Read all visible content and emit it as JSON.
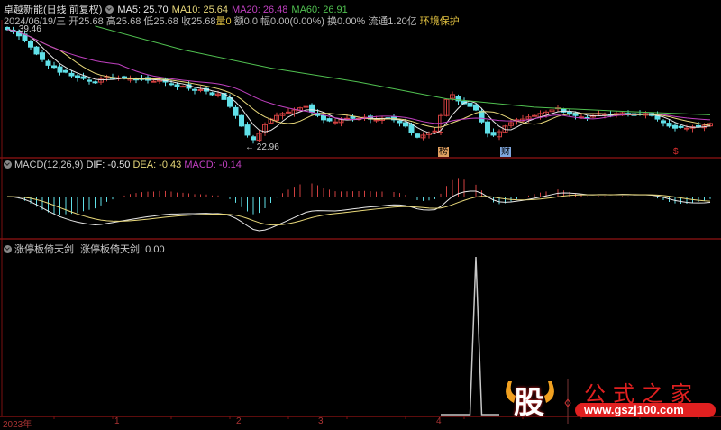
{
  "header": {
    "stock_name": "卓越新能(日线 前复权)",
    "ma5": "MA5: 25.70",
    "ma10": "MA10: 25.64",
    "ma20": "MA20: 26.48",
    "ma60": "MA60: 26.91",
    "date": "2024/06/19/三",
    "open": "开25.68",
    "high": "高25.68",
    "low": "低25.68",
    "close": "收25.68",
    "volume": "量0",
    "amount": "额0.0",
    "change": "幅0.00(0.00%)",
    "turnover": "换0.00%",
    "float_cap": "流通1.20亿",
    "concept": "环境保护"
  },
  "colors": {
    "ma5": "#e8e8e8",
    "ma10": "#e8d87a",
    "ma20": "#c040c0",
    "ma60": "#50c050",
    "up": "#d04040",
    "down": "#60e0e8",
    "frame": "#7a1010"
  },
  "main_pane": {
    "high_label": "39.46",
    "low_label": "22.96"
  },
  "markers": [
    {
      "text": "榜",
      "color": "#e0a060"
    },
    {
      "text": "财",
      "color": "#80a8e0"
    },
    {
      "text": "$",
      "color": "#e03030"
    }
  ],
  "macd_pane": {
    "title": "MACD(12,26,9)",
    "dif": "DIF: -0.50",
    "dea": "DEA: -0.43",
    "macd": "MACD: -0.14"
  },
  "signal_pane": {
    "title": "涨停板倚天剑",
    "value_label": "涨停板倚天剑: 0.00"
  },
  "time_axis": [
    "2023年",
    "1",
    "2",
    "3",
    "4"
  ],
  "watermark": {
    "logo_char": "股",
    "brand": "公式之家",
    "url": "www.gszj100.com"
  },
  "chart_data": {
    "type": "candlestick",
    "closes": [
      39.1,
      38.8,
      38.2,
      37.5,
      36.6,
      35.6,
      34.8,
      34.0,
      33.7,
      33.0,
      33.0,
      32.5,
      32.2,
      32.1,
      31.7,
      31.5,
      32.0,
      32.4,
      32.2,
      32.2,
      32.1,
      32.1,
      32.0,
      32.0,
      31.85,
      31.7,
      31.85,
      31.6,
      31.3,
      30.9,
      31.0,
      30.7,
      30.4,
      30.5,
      30.3,
      29.8,
      29.9,
      29.1,
      28.1,
      26.8,
      25.3,
      24.0,
      23.35,
      24.25,
      25.5,
      26.3,
      26.8,
      27.1,
      27.3,
      27.6,
      27.9,
      28.1,
      27.3,
      26.8,
      26.2,
      26.05,
      25.9,
      26.3,
      26.4,
      26.4,
      26.4,
      26.55,
      26.3,
      26.2,
      26.4,
      26.4,
      26.2,
      25.8,
      25.3,
      24.4,
      23.7,
      24.0,
      24.3,
      24.6,
      26.8,
      29.1,
      29.8,
      28.9,
      28.5,
      28.1,
      27.6,
      25.9,
      24.25,
      24.0,
      24.5,
      25.3,
      25.8,
      26.2,
      26.3,
      26.6,
      26.8,
      27.1,
      27.3,
      27.6,
      27.9,
      27.3,
      27.0,
      26.8,
      26.6,
      26.5,
      26.8,
      27.1,
      27.0,
      26.8,
      27.1,
      27.2,
      27.0,
      26.8,
      27.0,
      27.1,
      26.8,
      26.3,
      25.8,
      25.3,
      25.0,
      25.1,
      25.0,
      25.2,
      25.3,
      25.4,
      25.68
    ],
    "ma60": [
      [
        15,
        39.6
      ],
      [
        30,
        36.2
      ],
      [
        45,
        33.6
      ],
      [
        60,
        31.6
      ],
      [
        75,
        29.2
      ],
      [
        90,
        28.0
      ],
      [
        105,
        27.4
      ],
      [
        120,
        26.91
      ]
    ],
    "signal_peak_index": 80,
    "signal_values": [
      [
        74,
        0
      ],
      [
        79,
        0
      ],
      [
        80,
        1
      ],
      [
        81,
        0
      ],
      [
        84,
        0
      ]
    ],
    "price_range": [
      22.96,
      39.46
    ]
  }
}
